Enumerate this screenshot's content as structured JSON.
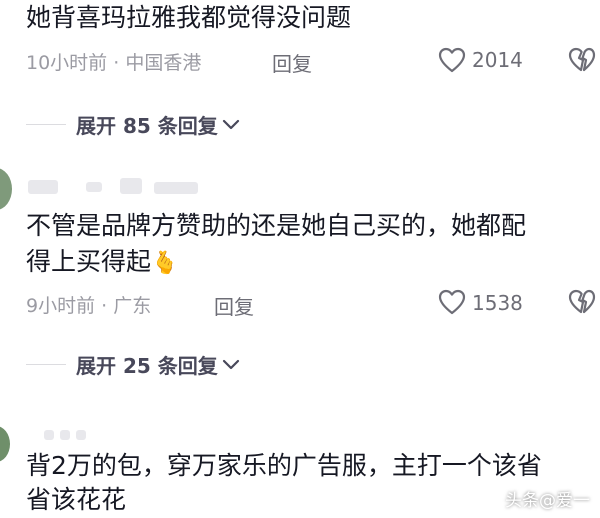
{
  "comments": [
    {
      "lines": [
        "她背喜玛拉雅我都觉得没问题"
      ],
      "time": "10小时前",
      "location": "中国香港",
      "reply_label": "回复",
      "likes": "2014",
      "expand_label": "展开 85 条回复"
    },
    {
      "lines": [
        "不管是品牌方赞助的还是她自己买的，她都配",
        "得上买得起"
      ],
      "emoji": "🫰",
      "time": "9小时前",
      "location": "广东",
      "reply_label": "回复",
      "likes": "1538",
      "expand_label": "展开 25 条回复"
    },
    {
      "lines": [
        "背2万的包，穿万家乐的广告服，主打一个该省",
        "省该花花"
      ]
    }
  ],
  "watermark": "头条@爱一",
  "icons": {
    "like": "heart-outline-icon",
    "dislike": "broken-heart-icon",
    "expand": "chevron-down-icon"
  },
  "colors": {
    "text": "#161823",
    "meta": "#9b9ba3",
    "action": "#6d6d76"
  }
}
